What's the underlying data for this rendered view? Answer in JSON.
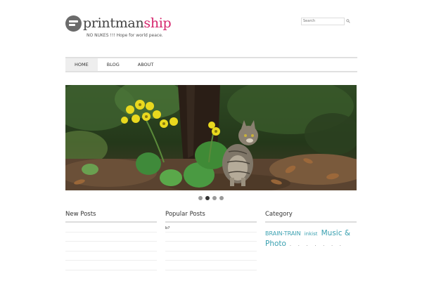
{
  "site": {
    "logo_left": "printman",
    "logo_right": "ship",
    "tagline": "NO NUKES !!! Hope for world peace."
  },
  "search": {
    "placeholder": "Search"
  },
  "nav": {
    "items": [
      "HOME",
      "BLOG",
      "ABOUT"
    ]
  },
  "slider": {
    "slide_count": 4,
    "active_index": 1
  },
  "columns": {
    "new_posts": {
      "title": "New Posts"
    },
    "popular_posts": {
      "title": "Popular Posts",
      "items": [
        "b?"
      ]
    },
    "category": {
      "title": "Category",
      "tags": [
        "BRAIN-TRAIN",
        "inkist",
        "Music & Photo"
      ],
      "trailing": ". .   .   .   .   .   ."
    }
  },
  "colors": {
    "accent": "#d6266d",
    "tag": "#3aa0b0"
  }
}
